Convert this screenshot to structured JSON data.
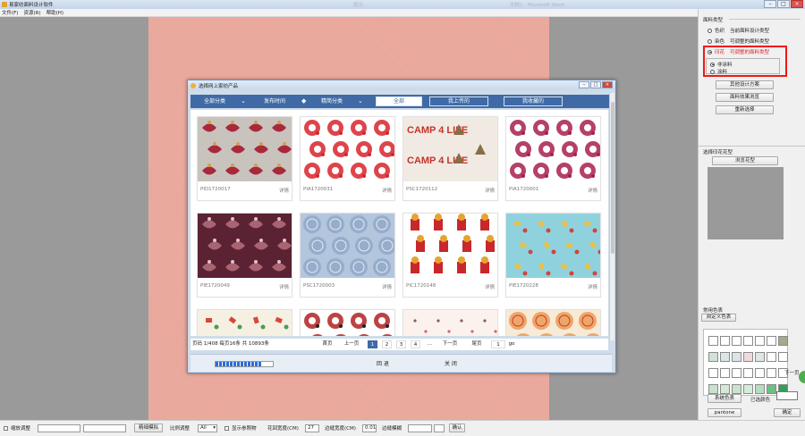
{
  "window": {
    "title": "易家纺面料设计软件",
    "ghost_left": "提示",
    "ghost_right": "文档1 - Microsoft Word"
  },
  "menu": [
    "文件(F)",
    "资源(R)",
    "帮助(H)"
  ],
  "right_panel": {
    "fabric_type_label": "面料类型",
    "options": [
      {
        "label": "色织",
        "desc": "当前面料设计类型",
        "checked": false,
        "highlight": false
      },
      {
        "label": "染色",
        "desc": "可调整的面料类型",
        "checked": false,
        "highlight": false
      },
      {
        "label": "印花",
        "desc": "可调整的面料类型",
        "checked": true,
        "highlight": true
      }
    ],
    "coating": [
      {
        "label": "非涂料",
        "checked": true
      },
      {
        "label": "涂料",
        "checked": false
      }
    ],
    "buttons": [
      "其他设计方案",
      "面料效果浏览",
      "重新选择"
    ],
    "print_label": "选择印花花型",
    "browse_button": "浏览花型",
    "common_colors": "常用色表",
    "custom_colors": "自定义色表",
    "next_page": "下一页",
    "system_colors": "系统色表",
    "selected_color": "已选颜色",
    "pantone": "pantone",
    "confirm": "确定",
    "swatches": [
      "#ffffff",
      "#ffffff",
      "#ffffff",
      "#ffffff",
      "#ffffff",
      "#ffffff",
      "#a8a88e",
      "#d2e2d6",
      "#d8e6e6",
      "#dce4ea",
      "#f2d8dc",
      "#dde8e0",
      "#ffffff",
      "#ffffff",
      "#ffffff",
      "#ffffff",
      "#ffffff",
      "#ffffff",
      "#ffffff",
      "#ffffff",
      "#ffffff",
      "#c8e2cd",
      "#d4e9d8",
      "#cbe2cf",
      "#d2eedc",
      "#b7ddc0",
      "#6fbe86",
      "#2f9f5c"
    ]
  },
  "bottom_bar": {
    "shrink_adjust": "缩放调整",
    "fine_simulate": "精细模拟",
    "scale_adjust": "比例调整",
    "scale_value": "All",
    "show_ref": "显示参照物",
    "pattern_width": "花回宽度(CM)",
    "pattern_width_value": "27",
    "edge_width": "边缝宽度(CM)",
    "edge_width_value": "0.01",
    "edge_blur": "边缝模糊",
    "confirm": "确认"
  },
  "dialog": {
    "title": "选择网上家纺产品",
    "tabs": [
      "全部分类",
      "发布时间",
      "精简分类"
    ],
    "filters": [
      "全部",
      "我上传的",
      "我收藏的"
    ],
    "active_filter": 0,
    "detail_label": "详情",
    "products": [
      {
        "name": "PID1720017",
        "colors": [
          "#c9c3be",
          "#a8283c",
          "#d2a04a"
        ],
        "kind": "ornament"
      },
      {
        "name": "PIA1720031",
        "colors": [
          "#ffffff",
          "#d8242c",
          "#d8242c"
        ],
        "kind": "floral"
      },
      {
        "name": "PSC1720112",
        "colors": [
          "#f1eae2",
          "#c3352c",
          "#8a6d45"
        ],
        "kind": "text",
        "text": "CAMP 4 LIFE"
      },
      {
        "name": "PIA1720001",
        "colors": [
          "#ffffff",
          "#a81e4e",
          "#a81e4e"
        ],
        "kind": "floral"
      },
      {
        "name": "PIE1720049",
        "colors": [
          "#5a2232",
          "#a86472",
          "#e2c2c6"
        ],
        "kind": "ornament"
      },
      {
        "name": "PSC1720003",
        "colors": [
          "#b3c6de",
          "#e6ecf4",
          "#8aa2c4"
        ],
        "kind": "circle"
      },
      {
        "name": "PIC1720148",
        "colors": [
          "#ffffff",
          "#c8282c",
          "#e5a42c"
        ],
        "kind": "character"
      },
      {
        "name": "PIE1720228",
        "colors": [
          "#8fd2de",
          "#e8c14a",
          "#d2443c"
        ],
        "kind": "scatter"
      },
      {
        "name": "",
        "colors": [
          "#f5f0e2",
          "#d6483a",
          "#4a9a5a"
        ],
        "kind": "scatter"
      },
      {
        "name": "",
        "colors": [
          "#ffffff",
          "#b22222",
          "#222222"
        ],
        "kind": "floral"
      },
      {
        "name": "",
        "colors": [
          "#fbf2ee",
          "#8a5a5a",
          "#d86464"
        ],
        "kind": "dots"
      },
      {
        "name": "",
        "colors": [
          "#f7ead6",
          "#c83a2a",
          "#e88a3a"
        ],
        "kind": "circle"
      }
    ],
    "pager": {
      "summary": "页码 1/408 每页16条 共 10893条",
      "first": "首页",
      "prev": "上一页",
      "pages": [
        "1",
        "2",
        "3",
        "4",
        "..."
      ],
      "next": "下一页",
      "last": "尾页",
      "input": "1",
      "go": "go"
    },
    "progress": 0.82,
    "back": "回 退",
    "close": "关 闭"
  }
}
